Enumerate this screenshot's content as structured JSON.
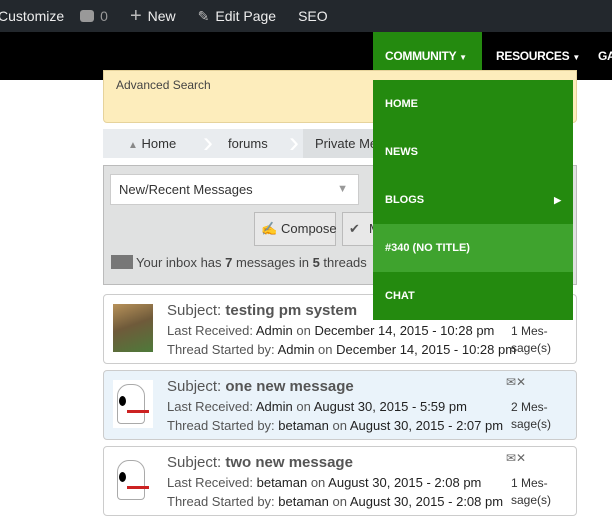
{
  "adminbar": {
    "customize": "Customize",
    "comments": "0",
    "new": "New",
    "edit": "Edit Page",
    "seo": "SEO"
  },
  "nav": {
    "community": "COMMUNITY",
    "resources": "RESOURCES",
    "ga": "GA"
  },
  "dropdown": {
    "items": [
      "HOME",
      "NEWS",
      "BLOGS",
      "#340 (NO TITLE)",
      "CHAT"
    ]
  },
  "search": {
    "advanced": "Advanced Search"
  },
  "breadcrumb": [
    "Home",
    "forums",
    "Private Me"
  ],
  "toolbar": {
    "folder": "New/Recent Messages",
    "compose": "Compose",
    "second": "M"
  },
  "inbox": {
    "pre": "Your inbox has ",
    "count": "7",
    "mid": " messages in ",
    "threads": "5",
    "post": " threads"
  },
  "labels": {
    "subject": "Subject: ",
    "last": "Last Received: ",
    "started": "Thread Started by: ",
    "on": " on "
  },
  "messages": [
    {
      "subject": "testing pm system",
      "last_by": "Admin",
      "last_on": "December 14, 2015 - 10:28 pm",
      "start_by": "Admin",
      "start_on": "December 14, 2015 - 10:28 pm",
      "count": "1 Mes-sage(s)"
    },
    {
      "subject": "one new message",
      "last_by": "Admin",
      "last_on": "August 30, 2015 - 5:59 pm",
      "start_by": "betaman",
      "start_on": "August 30, 2015 - 2:07 pm",
      "count": "2 Mes-sage(s)"
    },
    {
      "subject": "two new message",
      "last_by": "betaman",
      "last_on": "August 30, 2015 - 2:08 pm",
      "start_by": "betaman",
      "start_on": "August 30, 2015 - 2:08 pm",
      "count": "1 Mes-sage(s)"
    }
  ],
  "colors": {
    "green": "#248a0f",
    "green_active": "#3fa32e",
    "adminbar": "#23282d"
  }
}
